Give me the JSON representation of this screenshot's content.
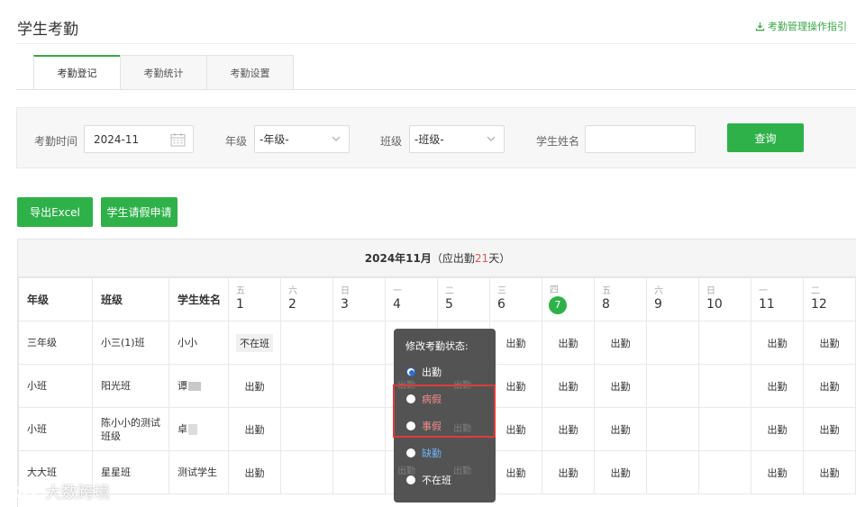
{
  "page": {
    "title": "学生考勤",
    "guide_link": "考勤管理操作指引"
  },
  "tabs": [
    {
      "label": "考勤登记",
      "active": true
    },
    {
      "label": "考勤统计",
      "active": false
    },
    {
      "label": "考勤设置",
      "active": false
    }
  ],
  "filter": {
    "time_label": "考勤时间",
    "time_value": "2024-11",
    "grade_label": "年级",
    "grade_value": "-年级-",
    "class_label": "班级",
    "class_value": "-班级-",
    "name_label": "学生姓名",
    "name_value": "",
    "query_label": "查询"
  },
  "actions": {
    "export_label": "导出Excel",
    "leave_label": "学生请假申请"
  },
  "grid": {
    "month": "2024年11月",
    "due_prefix": "（应出勤",
    "due_days": "21",
    "due_suffix": "天）",
    "columns": {
      "grade": "年级",
      "class": "班级",
      "name": "学生姓名"
    },
    "days": [
      {
        "w": "五",
        "d": "1"
      },
      {
        "w": "六",
        "d": "2"
      },
      {
        "w": "日",
        "d": "3"
      },
      {
        "w": "一",
        "d": "4"
      },
      {
        "w": "二",
        "d": "5"
      },
      {
        "w": "三",
        "d": "6"
      },
      {
        "w": "四",
        "d": "7"
      },
      {
        "w": "五",
        "d": "8"
      },
      {
        "w": "六",
        "d": "9"
      },
      {
        "w": "日",
        "d": "10"
      },
      {
        "w": "一",
        "d": "11"
      },
      {
        "w": "二",
        "d": "12"
      }
    ],
    "rows": [
      {
        "grade": "三年级",
        "class": "小三(1)班",
        "name": "小小",
        "cells": [
          "不在班",
          "",
          "",
          "",
          "",
          "出勤",
          "出勤",
          "出勤",
          "",
          "",
          "出勤",
          "出勤"
        ]
      },
      {
        "grade": "小班",
        "class": "阳光班",
        "name": "谭",
        "cells": [
          "出勤",
          "",
          "",
          "",
          "",
          "出勤",
          "出勤",
          "出勤",
          "",
          "",
          "出勤",
          "出勤"
        ]
      },
      {
        "grade": "小班",
        "class": "陈小小的测试班级",
        "name": "卓",
        "cells": [
          "出勤",
          "",
          "",
          "",
          "",
          "出勤",
          "出勤",
          "出勤",
          "",
          "",
          "出勤",
          "出勤"
        ]
      },
      {
        "grade": "大大班",
        "class": "星星班",
        "name": "测试学生",
        "cells": [
          "出勤",
          "",
          "",
          "",
          "",
          "出勤",
          "出勤",
          "出勤",
          "",
          "",
          "出勤",
          "出勤"
        ]
      }
    ]
  },
  "popup": {
    "title": "修改考勤状态:",
    "options": [
      {
        "label": "出勤",
        "color": "#ffffff",
        "selected": true
      },
      {
        "label": "病假",
        "color": "#f08a8a",
        "selected": false
      },
      {
        "label": "事假",
        "color": "#f08a8a",
        "selected": false
      },
      {
        "label": "缺勤",
        "color": "#6fb0f5",
        "selected": false
      },
      {
        "label": "不在班",
        "color": "#ffffff",
        "selected": false
      }
    ],
    "ghost_text": "出勤"
  },
  "watermark": "大数跨境",
  "colors": {
    "accent": "#2fb14a",
    "highlight": "#e03a3a",
    "leave": "#f08a8a",
    "absent": "#6fb0f5"
  }
}
